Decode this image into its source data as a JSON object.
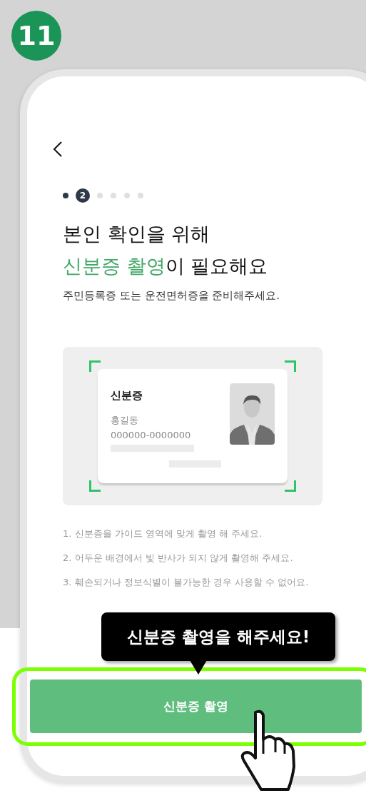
{
  "step_badge": "11",
  "progress": [
    {
      "kind": "done",
      "selected": false
    },
    {
      "kind": "current",
      "label": "2",
      "selected": true
    },
    {
      "kind": "todo",
      "selected": false
    },
    {
      "kind": "todo",
      "selected": false
    },
    {
      "kind": "todo",
      "selected": false
    },
    {
      "kind": "todo",
      "selected": false
    }
  ],
  "title": {
    "line_1": "본인 확인을 위해",
    "line_2_highlight": "신분증 촬영",
    "line_2_rest": "이 필요해요"
  },
  "subtitle": "주민등록증 또는 운전면허증을 준비해주세요.",
  "id_card": {
    "title": "신분증",
    "name": "홍길동",
    "number": "000000-0000000"
  },
  "notes": [
    "1. 신분증을 가이드 영역에 맞게 촬영 해 주세요.",
    "2. 어두운 배경에서 빛 반사가 되지 않게 촬영해 주세요.",
    "3. 훼손되거나 정보식별이 불가능한 경우 사용할 수 없어요."
  ],
  "tooltip": "신분증 촬영을 해주세요!",
  "button": {
    "label": "신분증 촬영",
    "highlighted": true
  }
}
